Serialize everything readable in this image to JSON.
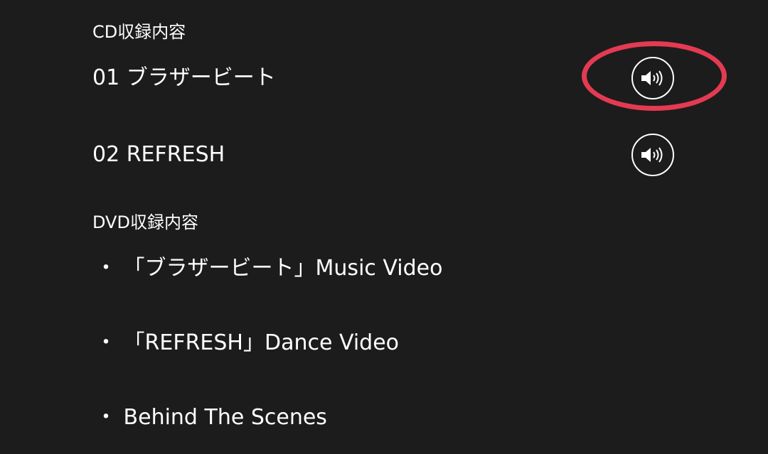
{
  "cd_section": {
    "label": "CD収録内容",
    "tracks": [
      {
        "title": "01 ブラザービート",
        "play_icon": "speaker-icon",
        "highlighted": true
      },
      {
        "title": "02 REFRESH",
        "play_icon": "speaker-icon",
        "highlighted": false
      }
    ]
  },
  "dvd_section": {
    "label": "DVD収録内容",
    "items": [
      "・ 「ブラザービート」Music Video",
      "・ 「REFRESH」Dance Video",
      "・ Behind The Scenes"
    ]
  },
  "colors": {
    "background": "#1c1c1c",
    "text": "#ffffff",
    "highlight": "#e43a52"
  }
}
